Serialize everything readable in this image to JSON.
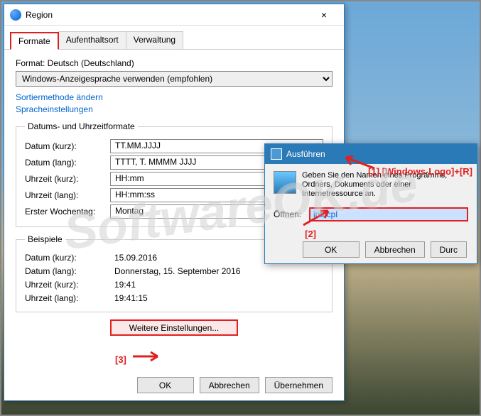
{
  "watermark": "SoftwareOK.de",
  "region": {
    "title": "Region",
    "tabs": {
      "formate": "Formate",
      "aufenthaltsort": "Aufenthaltsort",
      "verwaltung": "Verwaltung"
    },
    "format_label": "Format: Deutsch (Deutschland)",
    "format_combo": "Windows-Anzeigesprache verwenden (empfohlen)",
    "links": {
      "sortier": "Sortiermethode ändern",
      "sprache": "Spracheinstellungen"
    },
    "group_dt": "Datums- und Uhrzeitformate",
    "fields": {
      "datum_kurz_l": "Datum (kurz):",
      "datum_kurz_v": "TT.MM.JJJJ",
      "datum_lang_l": "Datum (lang):",
      "datum_lang_v": "TTTT, T. MMMM JJJJ",
      "uhrzeit_kurz_l": "Uhrzeit (kurz):",
      "uhrzeit_kurz_v": "HH:mm",
      "uhrzeit_lang_l": "Uhrzeit (lang):",
      "uhrzeit_lang_v": "HH:mm:ss",
      "wochentag_l": "Erster Wochentag:",
      "wochentag_v": "Montag"
    },
    "group_ex": "Beispiele",
    "examples": {
      "dk_l": "Datum (kurz):",
      "dk_v": "15.09.2016",
      "dl_l": "Datum (lang):",
      "dl_v": "Donnerstag, 15. September 2016",
      "uk_l": "Uhrzeit (kurz):",
      "uk_v": "19:41",
      "ul_l": "Uhrzeit (lang):",
      "ul_v": "19:41:15"
    },
    "btn_more": "Weitere Einstellungen...",
    "btn_ok": "OK",
    "btn_cancel": "Abbrechen",
    "btn_apply": "Übernehmen"
  },
  "run": {
    "title": "Ausführen",
    "desc": "Geben Sie den Namen eines Programms, Ordners, Dokuments oder einer Internetressource an.",
    "open_l": "Öffnen:",
    "open_v": "intl.cpl",
    "btn_ok": "OK",
    "btn_cancel": "Abbrechen",
    "btn_browse": "Durchsuchen"
  },
  "annot": {
    "a1": "[1] [Windows-Logo]+[R]",
    "a2": "[2]",
    "a3": "[3]"
  }
}
